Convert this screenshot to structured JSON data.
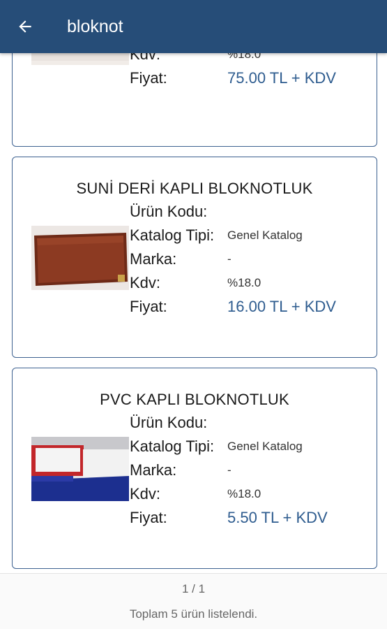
{
  "app_bar": {
    "title": "bloknot",
    "back_icon": "arrow-left-icon"
  },
  "labels": {
    "urun_kodu": "Ürün Kodu:",
    "katalog_tipi": "Katalog Tipi:",
    "marka": "Marka:",
    "kdv": "Kdv:",
    "fiyat": "Fiyat:"
  },
  "products": [
    {
      "name": "",
      "urun_kodu": "",
      "katalog_tipi": "",
      "marka": "",
      "kdv": "%18.0",
      "fiyat": "75.00 TL + KDV"
    },
    {
      "name": "SUNİ DERİ KAPLI BLOKNOTLUK",
      "urun_kodu": "",
      "katalog_tipi": "Genel Katalog",
      "marka": "-",
      "kdv": "%18.0",
      "fiyat": "16.00 TL + KDV"
    },
    {
      "name": "PVC KAPLI BLOKNOTLUK",
      "urun_kodu": "",
      "katalog_tipi": "Genel Katalog",
      "marka": "-",
      "kdv": "%18.0",
      "fiyat": "5.50 TL + KDV"
    }
  ],
  "footer": {
    "pager": "1 / 1",
    "total": "Toplam 5 ürün listelendi."
  },
  "colors": {
    "app_bar": "#264d78",
    "card_border": "#3d6190",
    "price": "#2e5c8f"
  }
}
